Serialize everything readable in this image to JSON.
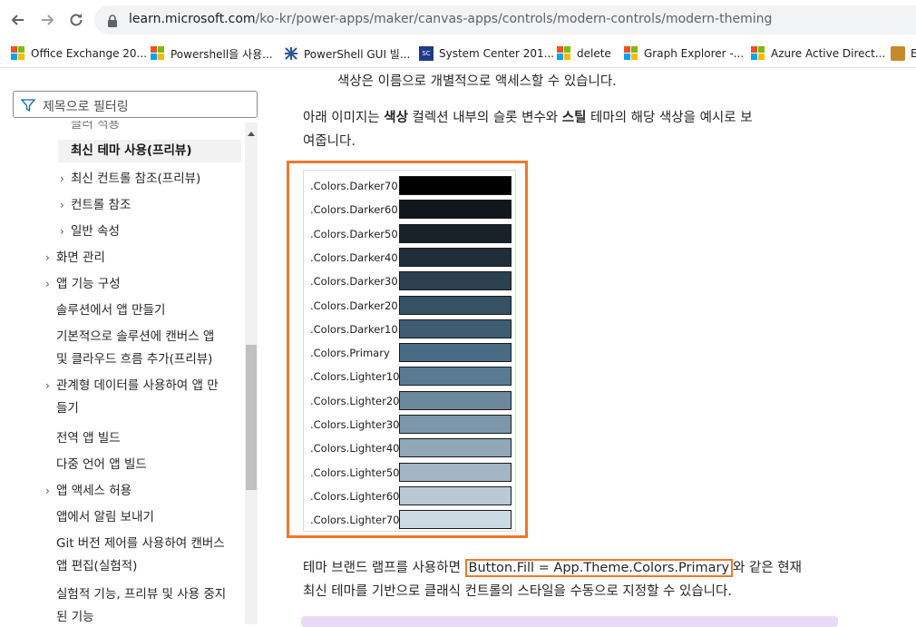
{
  "browser": {
    "url_host": "learn.microsoft.com",
    "url_path": "/ko-kr/power-apps/maker/canvas-apps/controls/modern-controls/modern-theming"
  },
  "bookmarks": [
    {
      "label": "Office Exchange 20...",
      "icon": "microsoft-logo-icon"
    },
    {
      "label": "Powershell을 사용...",
      "icon": "microsoft-logo-icon"
    },
    {
      "label": "PowerShell GUI 빌...",
      "icon": "powershell-gui-icon"
    },
    {
      "label": "System Center 201...",
      "icon": "system-center-icon"
    },
    {
      "label": "delete",
      "icon": "microsoft-logo-icon"
    },
    {
      "label": "Graph Explorer -...",
      "icon": "microsoft-logo-icon"
    },
    {
      "label": "Azure Active Direct...",
      "icon": "microsoft-logo-icon"
    },
    {
      "label": "E",
      "icon": "bookmark-icon"
    }
  ],
  "sidebar": {
    "filter_placeholder": "제목으로 필터링",
    "items": [
      {
        "label": "클러 적용",
        "chevron": false
      },
      {
        "label": "최신 테마 사용(프리뷰)",
        "chevron": false,
        "active": true
      },
      {
        "label": "최신 컨트롤 참조(프리뷰)",
        "chevron": true
      },
      {
        "label": "컨트롤 참조",
        "chevron": true
      },
      {
        "label": "일반 속성",
        "chevron": true
      },
      {
        "label": "화면 관리",
        "chevron": true
      },
      {
        "label": "앱 기능 구성",
        "chevron": true
      },
      {
        "label": "솔루션에서 앱 만들기",
        "chevron": false
      },
      {
        "label": "기본적으로 솔루션에 캔버스 앱",
        "chevron": false
      },
      {
        "label": "및 클라우드 흐름 추가(프리뷰)",
        "chevron": false
      },
      {
        "label": "관계형 데이터를 사용하여 앱 만",
        "chevron": true
      },
      {
        "label": "들기",
        "chevron": false
      },
      {
        "label": "전역 앱 빌드",
        "chevron": false
      },
      {
        "label": "다중 언어 앱 빌드",
        "chevron": false
      },
      {
        "label": "앱 액세스 허용",
        "chevron": true
      },
      {
        "label": "앱에서 알림 보내기",
        "chevron": false
      },
      {
        "label": "Git 버전 제어를 사용하여 캔버스",
        "chevron": false
      },
      {
        "label": "앱 편집(실험적)",
        "chevron": false
      },
      {
        "label": "실험적 기능, 프리뷰 및 사용 중지",
        "chevron": false
      },
      {
        "label": "된 기능",
        "chevron": false
      }
    ]
  },
  "content": {
    "line_top": "색상은 이름으로 개별적으로 액세스할 수 있습니다.",
    "intro_a": "아래 이미지는 ",
    "intro_b1": "색상",
    "intro_c": " 컬렉션 내부의 슬롯 변수와 ",
    "intro_b2": "스틸",
    "intro_d": " 테마의 해당 색상을 예시로 보",
    "intro_e": "여줍니다.",
    "bottom_a": "테마 브랜드 램프를 사용하면 ",
    "bottom_code": "Button.Fill = App.Theme.Colors.Primary",
    "bottom_b": "와 같은 현재",
    "bottom_c": "최신 테마를 기반으로 클래식 컨트롤의 스타일을 수동으로 지정할 수 있습니다."
  },
  "palette": [
    {
      "label": ".Colors.Darker70",
      "color": "#000000"
    },
    {
      "label": ".Colors.Darker60",
      "color": "#11171c"
    },
    {
      "label": ".Colors.Darker50",
      "color": "#182229"
    },
    {
      "label": ".Colors.Darker40",
      "color": "#1f2d38"
    },
    {
      "label": ".Colors.Darker30",
      "color": "#2b4150"
    },
    {
      "label": ".Colors.Darker20",
      "color": "#355163"
    },
    {
      "label": ".Colors.Darker10",
      "color": "#3e5d73"
    },
    {
      "label": ".Colors.Primary",
      "color": "#4a6b84"
    },
    {
      "label": ".Colors.Lighter10",
      "color": "#5a7a91"
    },
    {
      "label": ".Colors.Lighter20",
      "color": "#6b889d"
    },
    {
      "label": ".Colors.Lighter30",
      "color": "#7d97aa"
    },
    {
      "label": ".Colors.Lighter40",
      "color": "#91a8b9"
    },
    {
      "label": ".Colors.Lighter50",
      "color": "#a3b6c5"
    },
    {
      "label": ".Colors.Lighter60",
      "color": "#bac9d4"
    },
    {
      "label": ".Colors.Lighter70",
      "color": "#ccdae4"
    }
  ],
  "accent_color": "#f0782a"
}
